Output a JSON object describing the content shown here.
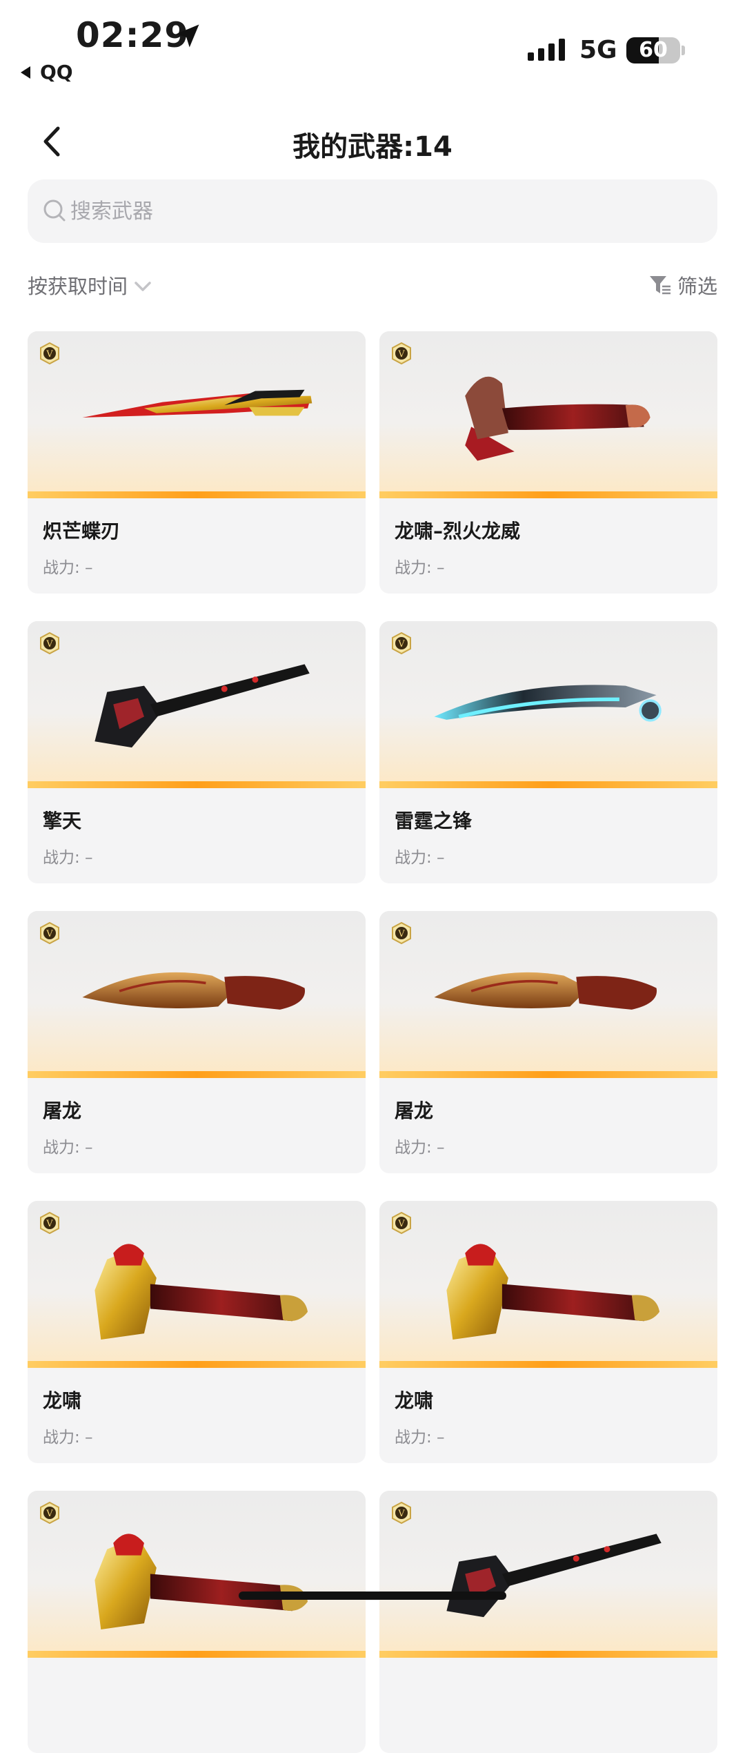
{
  "status_bar": {
    "time": "02:29",
    "back_app": "QQ",
    "network": "5G",
    "battery": "60"
  },
  "header": {
    "title": "我的武器:14"
  },
  "search": {
    "placeholder": "搜索武器"
  },
  "sort": {
    "label": "按获取时间"
  },
  "filter": {
    "label": "筛选"
  },
  "power_label": "战力: –",
  "weapons": [
    {
      "name": "炽芒蝶刃",
      "power": "战力: –",
      "icon": "butterfly-knife-icon"
    },
    {
      "name": "龙啸–烈火龙威",
      "power": "战力: –",
      "icon": "dragon-axe-red-icon"
    },
    {
      "name": "擎天",
      "power": "战力: –",
      "icon": "shovel-icon"
    },
    {
      "name": "雷霆之锋",
      "power": "战力: –",
      "icon": "curved-blade-icon"
    },
    {
      "name": "屠龙",
      "power": "战力: –",
      "icon": "kukri-icon"
    },
    {
      "name": "屠龙",
      "power": "战力: –",
      "icon": "kukri-icon"
    },
    {
      "name": "龙啸",
      "power": "战力: –",
      "icon": "dragon-axe-gold-icon"
    },
    {
      "name": "龙啸",
      "power": "战力: –",
      "icon": "dragon-axe-gold-icon"
    },
    {
      "name": "",
      "power": "",
      "icon": "dragon-axe-gold-icon"
    },
    {
      "name": "",
      "power": "",
      "icon": "shovel-icon"
    }
  ],
  "colors": {
    "accent": "#ff9f1a",
    "card_bg": "#f4f4f5",
    "muted_text": "#8c8c91"
  }
}
